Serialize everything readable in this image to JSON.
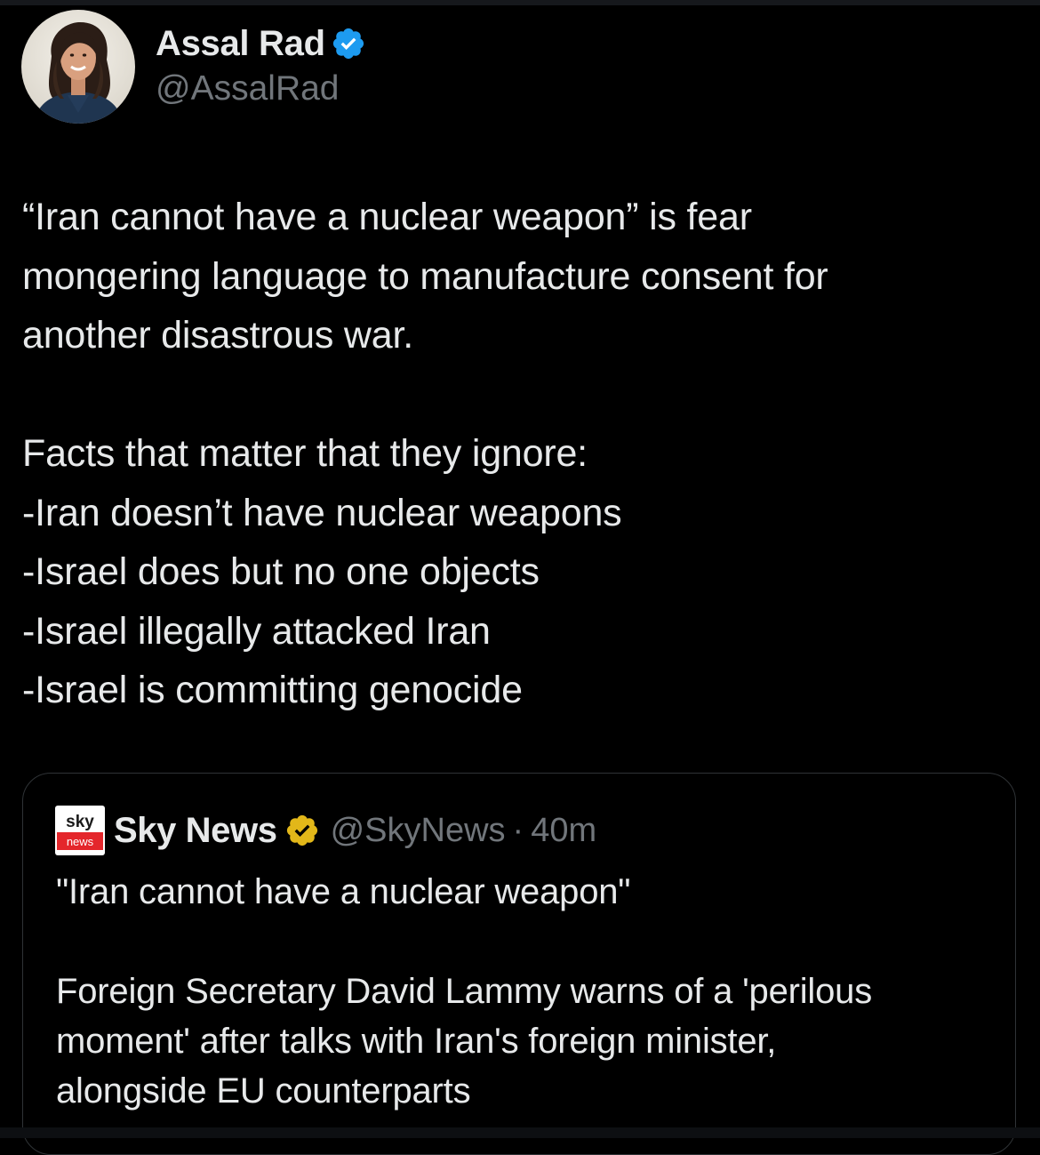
{
  "author": {
    "name": "Assal Rad",
    "handle": "@AssalRad",
    "avatar_icon": "profile-photo",
    "verified_icon": "blue-verified-check-icon"
  },
  "tweet": {
    "lines": [
      "“Iran cannot have a nuclear weapon” is fear",
      "mongering language to manufacture consent for",
      "another disastrous war.",
      "",
      "Facts that matter that they ignore:",
      "-Iran doesn’t have nuclear weapons",
      "-Israel does but no one objects",
      "-Israel illegally attacked Iran",
      "-Israel is committing genocide"
    ]
  },
  "quoted_tweet": {
    "name": "Sky News",
    "handle": "@SkyNews",
    "separator": "·",
    "time": "40m",
    "logo": {
      "top_text": "sky",
      "bottom_text": "news"
    },
    "verified_icon": "gold-verified-badge-icon",
    "lines": [
      "\"Iran cannot have a nuclear weapon\"",
      "",
      "Foreign Secretary David Lammy warns of a 'perilous",
      "moment' after talks with Iran's foreign minister,",
      "alongside EU counterparts"
    ]
  },
  "colors": {
    "background": "#000000",
    "text_primary": "#e7e9ea",
    "text_secondary": "#71767b",
    "verified_blue": "#1d9bf0",
    "verified_gold": "#e2b719",
    "border": "#2f3336",
    "sky_red": "#e4262b"
  }
}
